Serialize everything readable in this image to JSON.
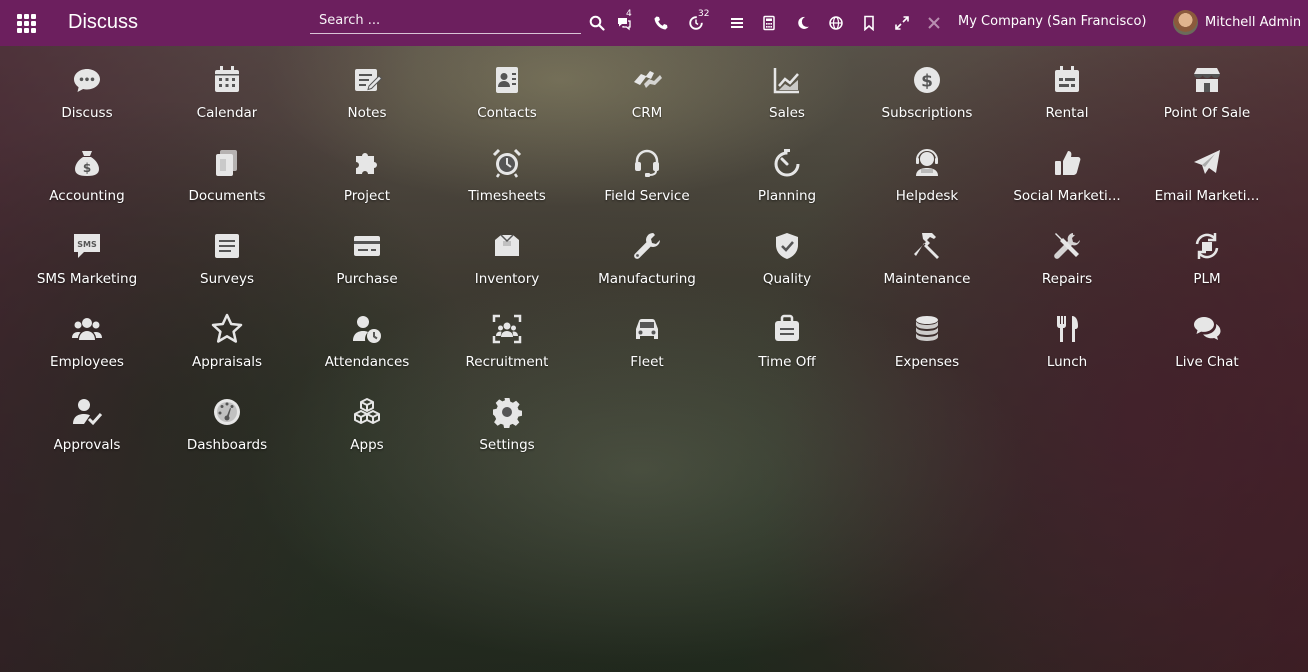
{
  "navbar": {
    "brand": "Discuss",
    "search_placeholder": "Search ...",
    "messages_badge": "4",
    "activities_badge": "32",
    "company": "My Company (San Francisco)",
    "user_name": "Mitchell Admin"
  },
  "apps": [
    {
      "label": "Discuss",
      "icon": "discuss-icon"
    },
    {
      "label": "Calendar",
      "icon": "calendar-icon"
    },
    {
      "label": "Notes",
      "icon": "notes-icon"
    },
    {
      "label": "Contacts",
      "icon": "contacts-icon"
    },
    {
      "label": "CRM",
      "icon": "crm-icon"
    },
    {
      "label": "Sales",
      "icon": "sales-icon"
    },
    {
      "label": "Subscriptions",
      "icon": "subscriptions-icon"
    },
    {
      "label": "Rental",
      "icon": "rental-icon"
    },
    {
      "label": "Point Of Sale",
      "icon": "point-of-sale-icon"
    },
    {
      "label": "Accounting",
      "icon": "accounting-icon"
    },
    {
      "label": "Documents",
      "icon": "documents-icon"
    },
    {
      "label": "Project",
      "icon": "project-icon"
    },
    {
      "label": "Timesheets",
      "icon": "timesheets-icon"
    },
    {
      "label": "Field Service",
      "icon": "field-service-icon"
    },
    {
      "label": "Planning",
      "icon": "planning-icon"
    },
    {
      "label": "Helpdesk",
      "icon": "helpdesk-icon"
    },
    {
      "label": "Social Marketi...",
      "icon": "social-marketing-icon"
    },
    {
      "label": "Email Marketi...",
      "icon": "email-marketing-icon"
    },
    {
      "label": "SMS Marketing",
      "icon": "sms-marketing-icon"
    },
    {
      "label": "Surveys",
      "icon": "surveys-icon"
    },
    {
      "label": "Purchase",
      "icon": "purchase-icon"
    },
    {
      "label": "Inventory",
      "icon": "inventory-icon"
    },
    {
      "label": "Manufacturing",
      "icon": "manufacturing-icon"
    },
    {
      "label": "Quality",
      "icon": "quality-icon"
    },
    {
      "label": "Maintenance",
      "icon": "maintenance-icon"
    },
    {
      "label": "Repairs",
      "icon": "repairs-icon"
    },
    {
      "label": "PLM",
      "icon": "plm-icon"
    },
    {
      "label": "Employees",
      "icon": "employees-icon"
    },
    {
      "label": "Appraisals",
      "icon": "appraisals-icon"
    },
    {
      "label": "Attendances",
      "icon": "attendances-icon"
    },
    {
      "label": "Recruitment",
      "icon": "recruitment-icon"
    },
    {
      "label": "Fleet",
      "icon": "fleet-icon"
    },
    {
      "label": "Time Off",
      "icon": "time-off-icon"
    },
    {
      "label": "Expenses",
      "icon": "expenses-icon"
    },
    {
      "label": "Lunch",
      "icon": "lunch-icon"
    },
    {
      "label": "Live Chat",
      "icon": "live-chat-icon"
    },
    {
      "label": "Approvals",
      "icon": "approvals-icon"
    },
    {
      "label": "Dashboards",
      "icon": "dashboards-icon"
    },
    {
      "label": "Apps",
      "icon": "apps-icon"
    },
    {
      "label": "Settings",
      "icon": "settings-icon"
    }
  ]
}
